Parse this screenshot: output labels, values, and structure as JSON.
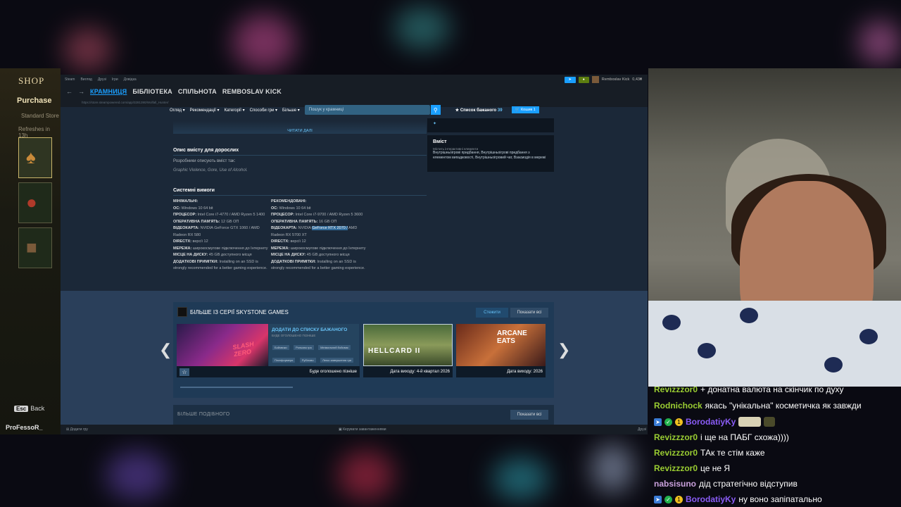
{
  "game_shop": {
    "title": "SHOP",
    "purchase": "Purchase",
    "standard": "Standard Store",
    "refresh": "Refreshes in 13h",
    "esc_key": "Esc",
    "back": "Back",
    "player": "ProFessoR_"
  },
  "steam": {
    "topbar": {
      "menu": [
        "Steam",
        "Вигляд",
        "Друзі",
        "Ігри",
        "Довідка"
      ],
      "account": "Remboslav Kick",
      "balance": "0,43₴"
    },
    "nav": {
      "tabs": [
        "КРАМНИЦЯ",
        "БІБЛІОТЕКА",
        "СПІЛЬНОТА",
        "REMBOSLAV KICK"
      ],
      "active_index": 0
    },
    "url": "https://store.steampowered.com/app/3281390/Wolfall_Hunter/",
    "store": {
      "links": [
        "Огляд",
        "Рекомендації",
        "Категорії",
        "Способи гри",
        "Більше"
      ],
      "search_placeholder": "Пошук у крамниці",
      "wishlist": "Список бажаного",
      "wishlist_count": "39",
      "cart": "Кошик",
      "cart_count": "1"
    },
    "readmore": "ЧИТАТИ ДАЛІ",
    "side": {
      "title": "Вміст",
      "label": "Містить інтерактивні елементи",
      "text": "Внутрішньоігрові придбання, Внутрішньоігрові придбання з елементом випадковості, Внутрішньоігровий чат, Взаємодія в мережі"
    },
    "mature": {
      "title": "Опис вмісту для дорослих",
      "line1": "Розробники описують вміст так:",
      "line2": "Graphic Violence, Gore, Use of Alcohol."
    },
    "sysreq": {
      "title": "Системні вимоги",
      "min": {
        "head": "МІНІМАЛЬНІ:",
        "rows": [
          {
            "k": "ОС:",
            "v": "Windows 10 64 bit"
          },
          {
            "k": "ПРОЦЕСОР:",
            "v": "Intel Core i7-4770 / AMD Ryzen 5 1400"
          },
          {
            "k": "ОПЕРАТИВНА ПАМ'ЯТЬ:",
            "v": "12 GB ОП"
          },
          {
            "k": "ВІДЕОКАРТА:",
            "v": "NVIDIA GeForce GTX 1060 / AMD Radeon RX 580"
          },
          {
            "k": "DIRECTX:",
            "v": "версії 12"
          },
          {
            "k": "МЕРЕЖА:",
            "v": "широкосмугове підключення до Інтернету"
          },
          {
            "k": "МІСЦЕ НА ДИСКУ:",
            "v": "45 GB доступного місця"
          },
          {
            "k": "ДОДАТКОВІ ПРИМІТКИ:",
            "v": "Installing on an SSD is strongly recommended for a better gaming experience."
          }
        ]
      },
      "rec": {
        "head": "РЕКОМЕНДОВАНІ:",
        "rows": [
          {
            "k": "ОС:",
            "v": "Windows 10 64 bit"
          },
          {
            "k": "ПРОЦЕСОР:",
            "v": "Intel Core i7-9700 / AMD Ryzen 5 3600"
          },
          {
            "k": "ОПЕРАТИВНА ПАМ'ЯТЬ:",
            "v": "16 GB ОП"
          },
          {
            "k": "ВІДЕОКАРТА:",
            "v": "NVIDIA",
            "hl": "GeForce RTX 2070 /",
            "v2": "AMD Radeon RX 5700 XT"
          },
          {
            "k": "DIRECTX:",
            "v": "версії 12"
          },
          {
            "k": "МЕРЕЖА:",
            "v": "широкосмугове підключення до Інтернету"
          },
          {
            "k": "МІСЦЕ НА ДИСКУ:",
            "v": "45 GB доступного місця"
          },
          {
            "k": "ДОДАТКОВІ ПРИМІТКИ:",
            "v": "Installing on an SSD is strongly recommended for a better gaming experience."
          }
        ]
      }
    },
    "series": {
      "title": "БІЛЬШЕ ІЗ СЕРІЇ SKYSTONE GAMES",
      "follow": "Стежити",
      "show_all": "Показати всі",
      "cards": [
        {
          "meta": "Буде оголошено пізніше",
          "add": "ДОДАТИ ДО СПИСКУ БАЖАНОГО",
          "tbd": "БУДЕ ОГОЛОШЕНО ПІЗНІШЕ",
          "tags": [
            "Бойовики",
            "Рольова гра",
            "Мінімальний бойовик",
            "Платформери",
            "Рубілово",
            "Легко завершення гри"
          ],
          "art_text": "SLASH ZERO"
        },
        {
          "meta": "Дата виходу: 4-й квартал 2026",
          "art_text": "HELLCARD II"
        },
        {
          "meta": "Дата виходу: 2026",
          "art_text": "ARCANE EATS"
        }
      ]
    },
    "more_like": {
      "title": "БІЛЬШЕ ПОДІБНОГО",
      "show_all": "Показати всі"
    },
    "statusbar": {
      "add_game": "Додати гру",
      "downloads": "Керувати завантаженнями",
      "friends": "Друзі"
    }
  },
  "chat": [
    {
      "user": "Revizzzor0",
      "color": "#9acd32",
      "text": "+ донатна валюта на скінчик по духу",
      "badges": []
    },
    {
      "user": "Rodnichock",
      "color": "#9acd32",
      "text": "якась \"унікальна\" косметичка як завжди",
      "badges": []
    },
    {
      "user": "BorodatiyKy",
      "color": "#8a5cf6",
      "text": "",
      "badges": [
        "b1",
        "b2",
        "b3"
      ],
      "emotes": 2
    },
    {
      "user": "Revizzzor0",
      "color": "#9acd32",
      "text": "і ще на ПАБГ схожа))))",
      "badges": []
    },
    {
      "user": "Revizzzor0",
      "color": "#9acd32",
      "text": "ТАк те стім каже",
      "badges": []
    },
    {
      "user": "Revizzzor0",
      "color": "#9acd32",
      "text": "це не Я",
      "badges": []
    },
    {
      "user": "nabsisuno",
      "color": "#c9a0dc",
      "text": "дід стратегічно відступив",
      "badges": []
    },
    {
      "user": "BorodatiyKy",
      "color": "#8a5cf6",
      "text": "ну воно запіпатально",
      "badges": [
        "b1",
        "b2",
        "b3"
      ]
    }
  ],
  "icons": {
    "search": "search-icon",
    "star": "star-icon",
    "cart": "cart-icon",
    "arrow_left": "chevron-left-icon",
    "arrow_right": "chevron-right-icon"
  }
}
